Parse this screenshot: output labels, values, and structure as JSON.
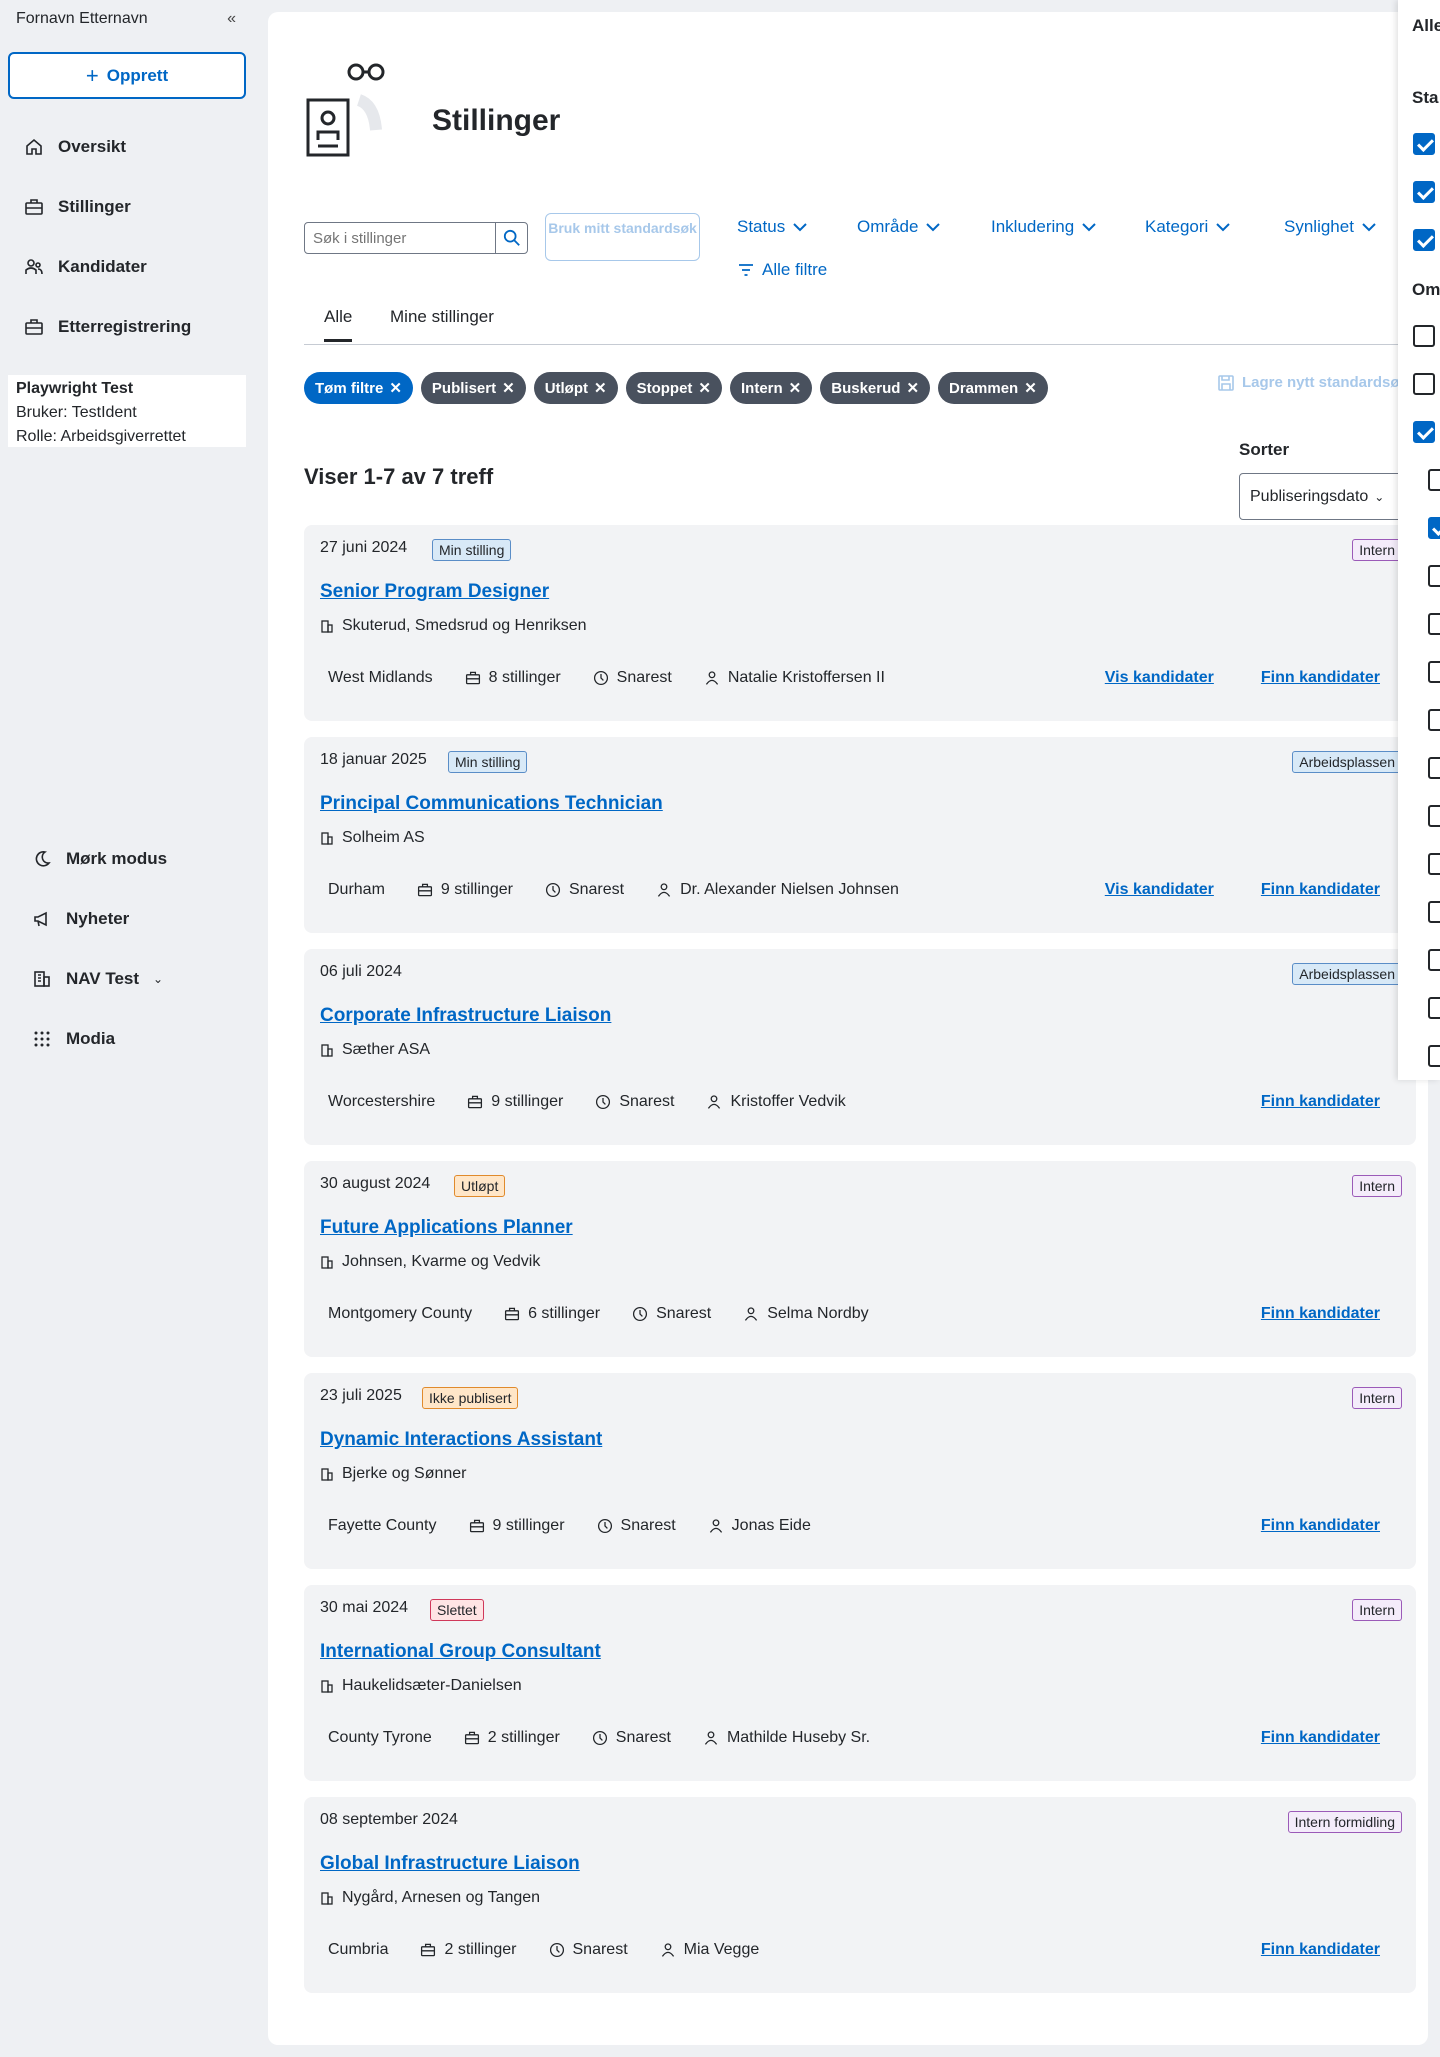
{
  "sidebar": {
    "user_name": "Fornavn Etternavn",
    "collapse_label": "«",
    "create_label": "Opprett",
    "nav": [
      {
        "label": "Oversikt",
        "icon": "home-icon"
      },
      {
        "label": "Stillinger",
        "icon": "briefcase-icon"
      },
      {
        "label": "Kandidater",
        "icon": "people-icon"
      },
      {
        "label": "Etterregistrering",
        "icon": "briefcase-icon"
      }
    ],
    "info": {
      "line1": "Playwright Test",
      "line2": "Bruker: TestIdent",
      "line3": "Rolle: Arbeidsgiverrettet"
    },
    "bottom": [
      {
        "label": "Mørk modus",
        "icon": "moon-icon"
      },
      {
        "label": "Nyheter",
        "icon": "megaphone-icon"
      },
      {
        "label": "NAV Test",
        "icon": "building-icon"
      },
      {
        "label": "Modia",
        "icon": "grid-icon"
      }
    ]
  },
  "main": {
    "title": "Stillinger",
    "search_placeholder": "Søk i stillinger",
    "std_search_label": "Bruk mitt standardsøk",
    "filters": [
      "Status",
      "Område",
      "Inkludering",
      "Kategori",
      "Synlighet"
    ],
    "all_filters_label": "Alle filtre",
    "tabs": [
      "Alle",
      "Mine stillinger"
    ],
    "chips": [
      "Tøm filtre",
      "Publisert",
      "Utløpt",
      "Stoppet",
      "Intern",
      "Buskerud",
      "Drammen"
    ],
    "save_std_label": "Lagre nytt standardsøk",
    "result_count": "Viser 1-7 av 7 treff",
    "sort_label": "Sorter",
    "sort_value": "Publiseringsdato"
  },
  "jobs": [
    {
      "date": "27 juni 2024",
      "status": "Min stilling",
      "visibility": "Intern",
      "title": "Senior Program Designer",
      "employer": "Skuterud, Smedsrud og Henriksen",
      "location": "West Midlands",
      "positions": "8 stillinger",
      "deadline": "Snarest",
      "contact": "Natalie Kristoffersen II",
      "show_candidates": "Vis kandidater",
      "find_candidates": "Finn kandidater"
    },
    {
      "date": "18 januar 2025",
      "status": "Min stilling",
      "visibility": "Arbeidsplassen",
      "title": "Principal Communications Technician",
      "employer": "Solheim AS",
      "location": "Durham",
      "positions": "9 stillinger",
      "deadline": "Snarest",
      "contact": "Dr. Alexander Nielsen Johnsen",
      "show_candidates": "Vis kandidater",
      "find_candidates": "Finn kandidater"
    },
    {
      "date": "06 juli 2024",
      "status": "",
      "visibility": "Arbeidsplassen",
      "title": "Corporate Infrastructure Liaison",
      "employer": "Sæther ASA",
      "location": "Worcestershire",
      "positions": "9 stillinger",
      "deadline": "Snarest",
      "contact": "Kristoffer Vedvik",
      "show_candidates": "",
      "find_candidates": "Finn kandidater"
    },
    {
      "date": "30 august 2024",
      "status": "Utløpt",
      "visibility": "Intern",
      "title": "Future Applications Planner",
      "employer": "Johnsen, Kvarme og Vedvik",
      "location": "Montgomery County",
      "positions": "6 stillinger",
      "deadline": "Snarest",
      "contact": "Selma Nordby",
      "show_candidates": "",
      "find_candidates": "Finn kandidater"
    },
    {
      "date": "23 juli 2025",
      "status": "Ikke publisert",
      "visibility": "Intern",
      "title": "Dynamic Interactions Assistant",
      "employer": "Bjerke og Sønner",
      "location": "Fayette County",
      "positions": "9 stillinger",
      "deadline": "Snarest",
      "contact": "Jonas Eide",
      "show_candidates": "",
      "find_candidates": "Finn kandidater"
    },
    {
      "date": "30 mai 2024",
      "status": "Slettet",
      "visibility": "Intern",
      "title": "International Group Consultant",
      "employer": "Haukelidsæter-Danielsen",
      "location": "County Tyrone",
      "positions": "2 stillinger",
      "deadline": "Snarest",
      "contact": "Mathilde Huseby Sr.",
      "show_candidates": "",
      "find_candidates": "Finn kandidater"
    },
    {
      "date": "08 september 2024",
      "status": "",
      "visibility": "Intern formidling",
      "title": "Global Infrastructure Liaison",
      "employer": "Nygård, Arnesen og Tangen",
      "location": "Cumbria",
      "positions": "2 stillinger",
      "deadline": "Snarest",
      "contact": "Mia Vegge",
      "show_candidates": "",
      "find_candidates": "Finn kandidater"
    }
  ],
  "right_panel": {
    "title": "Alle",
    "section1": "Sta",
    "section2": "Om"
  }
}
